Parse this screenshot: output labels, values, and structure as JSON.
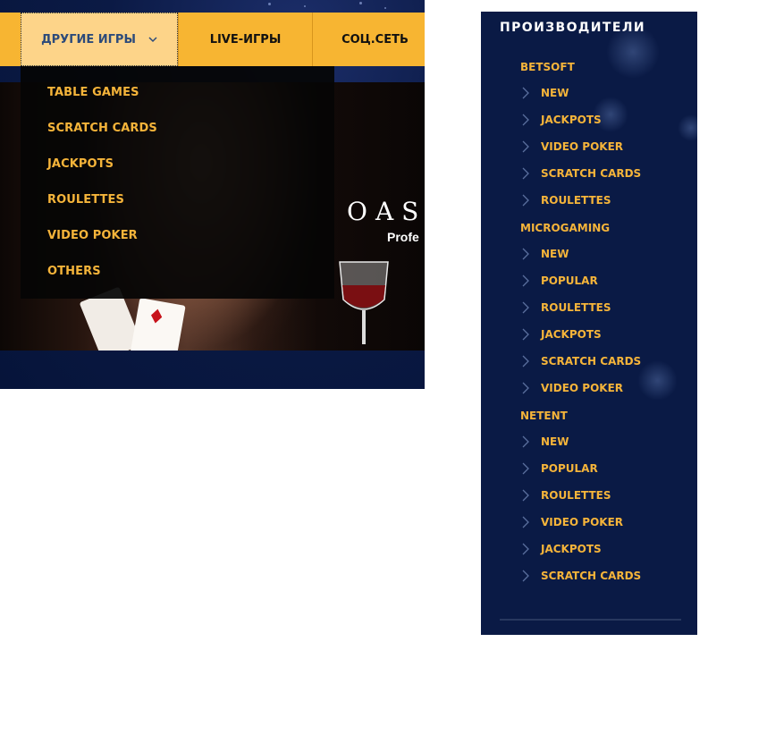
{
  "nav": {
    "items": [
      {
        "label": "ДРУГИЕ ИГРЫ",
        "active": true
      },
      {
        "label": "LIVE-ИГРЫ",
        "active": false
      },
      {
        "label": "СОЦ.СЕТЬ",
        "active": false
      }
    ]
  },
  "dropdown": {
    "items": [
      "TABLE GAMES",
      "SCRATCH CARDS",
      "JACKPOTS",
      "ROULETTES",
      "VIDEO POKER",
      "OTHERS"
    ]
  },
  "banner": {
    "logo": "OAS",
    "sub": "Profe"
  },
  "sidebar": {
    "title": "ПРОИЗВОДИТЕЛИ",
    "providers": [
      {
        "name": "BETSOFT",
        "items": [
          "NEW",
          "JACKPOTS",
          "VIDEO POKER",
          "SCRATCH CARDS",
          "ROULETTES"
        ]
      },
      {
        "name": "MICROGAMING",
        "items": [
          "NEW",
          "POPULAR",
          "ROULETTES",
          "JACKPOTS",
          "SCRATCH CARDS",
          "VIDEO POKER"
        ]
      },
      {
        "name": "NETENT",
        "items": [
          "NEW",
          "POPULAR",
          "ROULETTES",
          "VIDEO POKER",
          "JACKPOTS",
          "SCRATCH CARDS"
        ]
      }
    ]
  },
  "colors": {
    "nav_bg": "#f7b532",
    "nav_active_bg": "#fdd489",
    "accent_text": "#f5b43a",
    "panel_bg": "#0a1a45"
  },
  "icons": {
    "nav_dropdown": "chevron-down-icon",
    "sidebar_item": "chevron-right-icon"
  }
}
